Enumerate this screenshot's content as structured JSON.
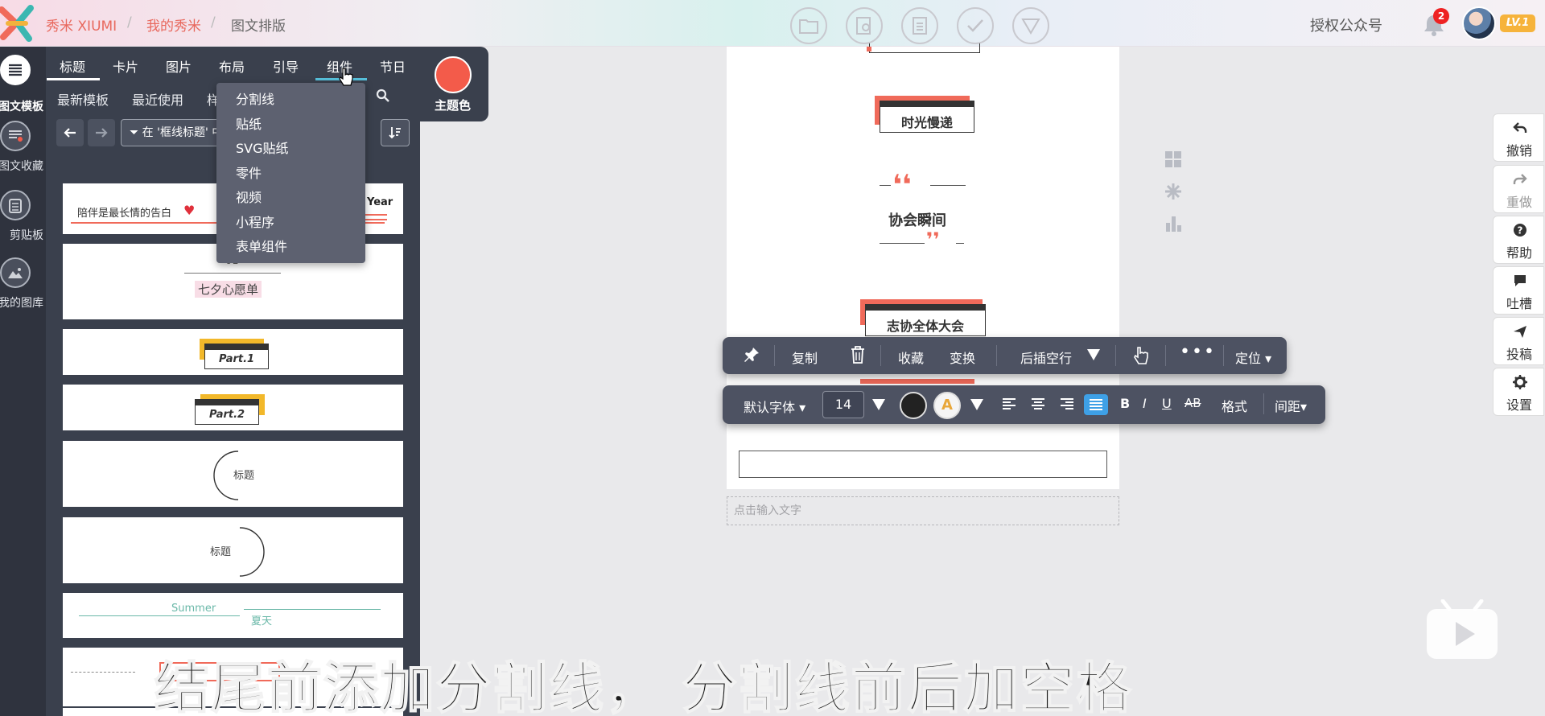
{
  "topbar": {
    "brand": "秀米 XIUMI",
    "crumb_sep": "/",
    "crumb_mine": "我的秀米",
    "crumb_current": "图文排版",
    "auth_label": "授权公众号",
    "notification_count": "2",
    "level": "LV.1"
  },
  "leftnav": {
    "items": [
      {
        "label": "图文模板",
        "icon": "list-icon"
      },
      {
        "label": "图文收藏",
        "icon": "favorites-icon"
      },
      {
        "label": "剪贴板",
        "icon": "clipboard-icon"
      },
      {
        "label": "我的图库",
        "icon": "image-library-icon"
      }
    ]
  },
  "panel": {
    "tabs": [
      "标题",
      "卡片",
      "图片",
      "布局",
      "引导",
      "组件",
      "节日"
    ],
    "active_tab": "标题",
    "hovered_tab": "组件",
    "subtabs": [
      "最新模板",
      "最近使用",
      "样"
    ],
    "filter_label": "在 '框线标题' 中",
    "theme_label": "主题色",
    "theme_color": "#f35b4a"
  },
  "dropdown": {
    "items": [
      "分割线",
      "贴纸",
      "SVG贴纸",
      "零件",
      "视频",
      "小程序",
      "表单组件"
    ]
  },
  "templates": {
    "t1_text": "陪伴是最长情的告白",
    "t1_year": "Year",
    "t2_number": "01",
    "t2_text": "七夕心愿单",
    "t3_text": "Part.1",
    "t4_text": "Part.2",
    "t5_text": "标题",
    "t6_text": "标题",
    "t7_en": "Summer",
    "t7_cn": "夏天"
  },
  "editor": {
    "title1": "时光慢递",
    "title2": "协会瞬间",
    "title3": "志协全体大会",
    "input_hint": "点击输入文字"
  },
  "toolbar1": {
    "copy": "复制",
    "collect": "收藏",
    "transform": "变换",
    "insert_after": "后插空行",
    "locate": "定位"
  },
  "toolbar2": {
    "font": "默认字体",
    "size": "14",
    "bold": "B",
    "italic": "I",
    "underline": "U",
    "strike": "AB",
    "format": "格式",
    "spacing": "间距",
    "text_color": "#222222"
  },
  "rightbar": [
    {
      "label": "撤销",
      "icon": "undo-icon"
    },
    {
      "label": "重做",
      "icon": "redo-icon"
    },
    {
      "label": "帮助",
      "icon": "help-icon"
    },
    {
      "label": "吐槽",
      "icon": "comment-icon"
    },
    {
      "label": "投稿",
      "icon": "send-icon"
    },
    {
      "label": "设置",
      "icon": "gear-icon"
    }
  ],
  "subtitle": "结尾前添加分割线， 分割线前后加空格"
}
